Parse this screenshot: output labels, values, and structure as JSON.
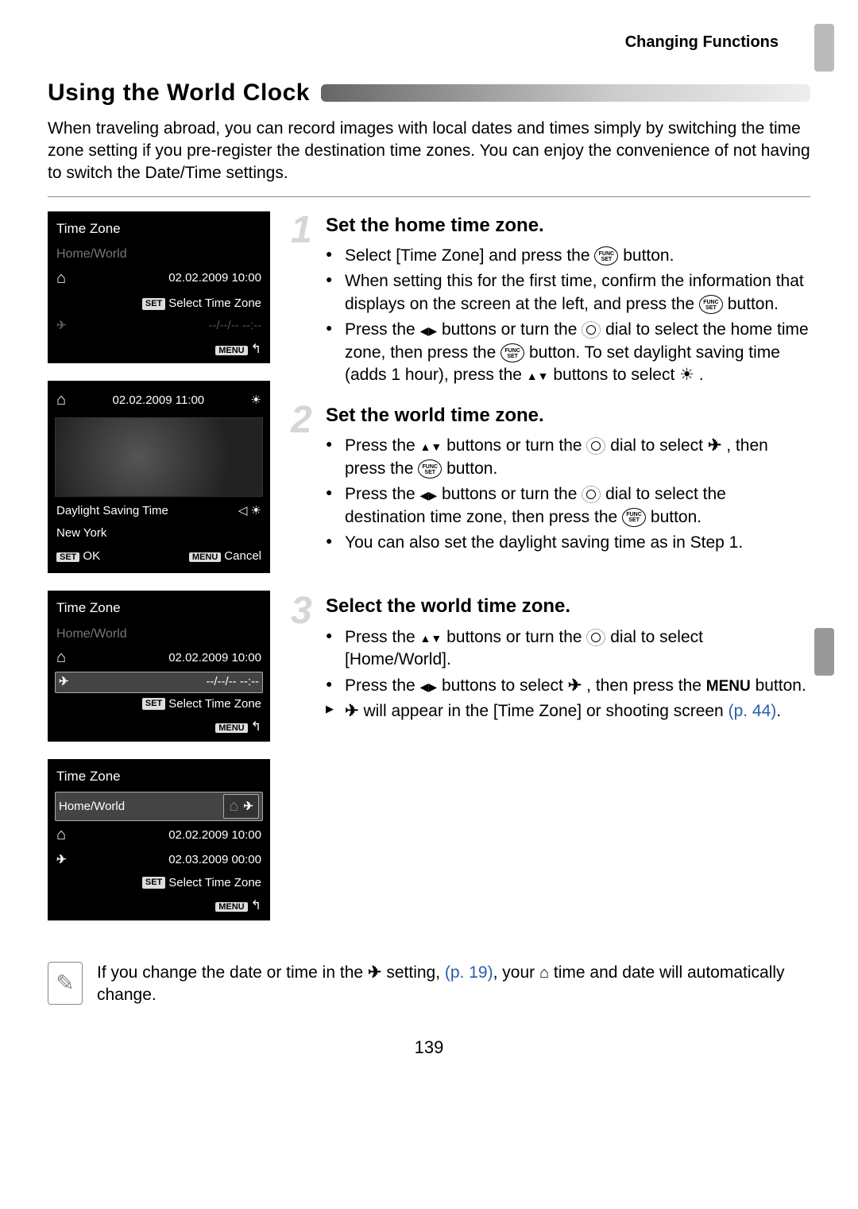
{
  "header": {
    "section": "Changing Functions"
  },
  "title": "Using the World Clock",
  "intro": "When traveling abroad, you can record images with local dates and times simply by switching the time zone setting if you pre-register the destination time zones. You can enjoy the convenience of not having to switch the Date/Time settings.",
  "screens": {
    "s1": {
      "title": "Time Zone",
      "sub": "Home/World",
      "home_date": "02.02.2009 10:00",
      "select_label": "Select Time Zone",
      "set": "SET",
      "menu": "MENU"
    },
    "s2": {
      "top_date": "02.02.2009 11:00",
      "dst": "Daylight Saving Time",
      "city": "New York",
      "set": "SET",
      "ok": "OK",
      "menu": "MENU",
      "cancel": "Cancel"
    },
    "s3": {
      "title": "Time Zone",
      "sub": "Home/World",
      "home_date": "02.02.2009 10:00",
      "world_date": "--/--/-- --:--",
      "select_label": "Select Time Zone",
      "set": "SET",
      "menu": "MENU"
    },
    "s4": {
      "title": "Time Zone",
      "sub": "Home/World",
      "home_date": "02.02.2009 10:00",
      "world_date": "02.03.2009 00:00",
      "select_label": "Select Time Zone",
      "set": "SET",
      "menu": "MENU"
    }
  },
  "steps": {
    "one": {
      "num": "1",
      "heading": "Set the home time zone.",
      "b1a": "Select [Time Zone] and press the ",
      "b1b": " button.",
      "b2a": "When setting this for the first time, confirm the information that displays on the screen at the left, and press the ",
      "b2b": " button.",
      "b3a": "Press the ",
      "b3b": " buttons or turn the ",
      "b3c": " dial to select the home time zone, then press the ",
      "b3d": " button. To set daylight saving time (adds 1 hour), press the ",
      "b3e": " buttons to select ",
      "b3f": "."
    },
    "two": {
      "num": "2",
      "heading": "Set the world time zone.",
      "b1a": "Press the ",
      "b1b": " buttons or turn the ",
      "b1c": " dial to select ",
      "b1d": ", then press the ",
      "b1e": " button.",
      "b2a": "Press the ",
      "b2b": " buttons or turn the ",
      "b2c": " dial to select the destination time zone, then press the ",
      "b2d": " button.",
      "b3": "You can also set the daylight saving time as in Step 1."
    },
    "three": {
      "num": "3",
      "heading": "Select the world time zone.",
      "b1a": "Press the ",
      "b1b": " buttons or turn the ",
      "b1c": " dial to select [Home/World].",
      "b2a": "Press the ",
      "b2b": " buttons to select ",
      "b2c": ", then press the ",
      "b2d": " button.",
      "menu_word": "MENU",
      "b3a": " will appear in the [Time Zone] or shooting screen ",
      "b3ref": "(p. 44)",
      "b3b": "."
    }
  },
  "note": {
    "a": "If you change the date or time in the ",
    "b": " setting, ",
    "ref": "(p. 19)",
    "c": ", your ",
    "d": " time and date will automatically change."
  },
  "pagenum": "139"
}
